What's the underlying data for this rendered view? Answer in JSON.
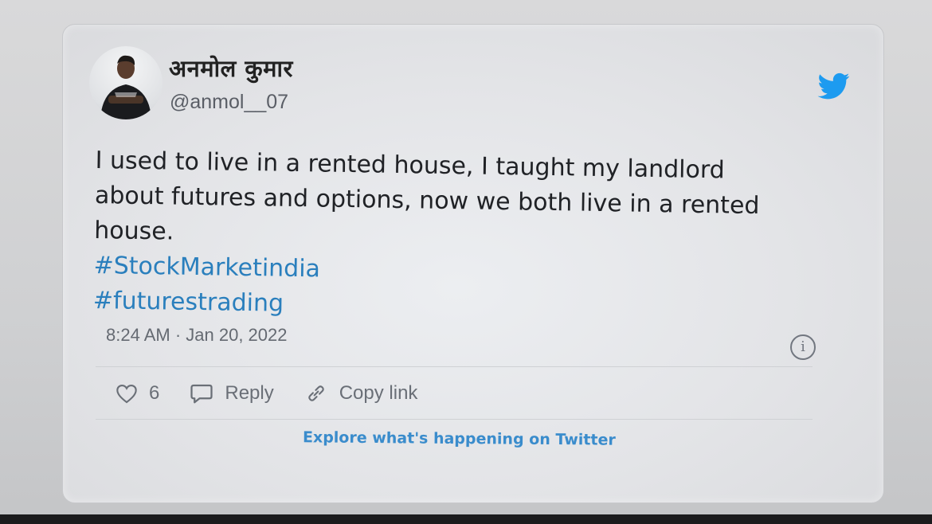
{
  "user": {
    "display_name": "अनमोल कुमार",
    "handle": "@anmol__07"
  },
  "tweet": {
    "lines": [
      "I used to live in a rented house, I taught my landlord",
      "about futures and options, now we both live in a rented",
      "house."
    ],
    "hashtags": [
      "#StockMarketindia",
      "#futurestrading"
    ],
    "timestamp": "8:24 AM · Jan 20, 2022"
  },
  "actions": {
    "like_count": "6",
    "reply_label": "Reply",
    "copy_link_label": "Copy link"
  },
  "footer": {
    "explore_label": "Explore what's happening on Twitter"
  },
  "icons": {
    "brand": "twitter-bird-icon",
    "info": "info-icon",
    "like": "heart-icon",
    "reply": "speech-bubble-icon",
    "copy": "link-icon"
  },
  "colors": {
    "brand": "#1d9bf0",
    "hashtag": "#2a7fbd",
    "text": "#202226",
    "muted": "#656a72"
  }
}
